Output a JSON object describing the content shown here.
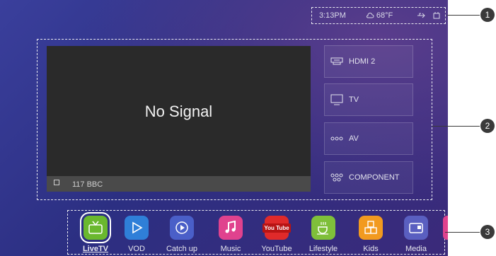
{
  "status": {
    "time": "3:13PM",
    "temperature": "68°F"
  },
  "preview": {
    "message": "No Signal",
    "channel": "117 BBC"
  },
  "sources": [
    {
      "label": "HDMI 2",
      "icon": "hdmi-icon"
    },
    {
      "label": "TV",
      "icon": "tv-icon"
    },
    {
      "label": "AV",
      "icon": "av-icon"
    },
    {
      "label": "COMPONENT",
      "icon": "component-icon"
    }
  ],
  "apps": [
    {
      "label": "LiveTV",
      "icon": "live-tv-icon",
      "color": "#6ab82e",
      "selected": true
    },
    {
      "label": "VOD",
      "icon": "play-icon",
      "color": "#2f7fd8"
    },
    {
      "label": "Catch up",
      "icon": "catch-up-icon",
      "color": "#4a5fc8"
    },
    {
      "label": "Music",
      "icon": "music-icon",
      "color": "#e0428e"
    },
    {
      "label": "YouTube",
      "icon": "youtube-icon",
      "color": "#e02a2a"
    },
    {
      "label": "Lifestyle",
      "icon": "cup-icon",
      "color": "#7fbf3a"
    },
    {
      "label": "Kids",
      "icon": "kids-blocks-icon",
      "color": "#f29a1f"
    },
    {
      "label": "Media",
      "icon": "media-icon",
      "color": "#5a5fc0"
    }
  ],
  "callouts": [
    "1",
    "2",
    "3"
  ],
  "icon_glyphs": {
    "youtube": "You Tube"
  }
}
